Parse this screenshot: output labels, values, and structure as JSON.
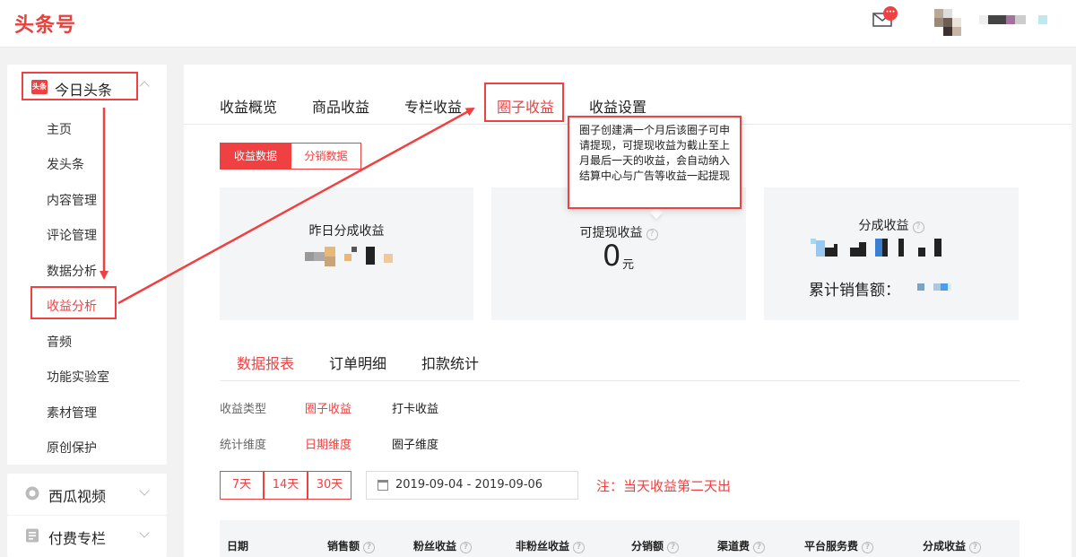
{
  "header": {
    "logo": "头条号",
    "mail_badge": "···",
    "colors": {
      "brand": "#e8403d",
      "accent": "#f04142"
    }
  },
  "sidebar": {
    "section_title": "今日头条",
    "section_icon": "头条",
    "items": [
      {
        "label": "主页"
      },
      {
        "label": "发头条"
      },
      {
        "label": "内容管理"
      },
      {
        "label": "评论管理"
      },
      {
        "label": "数据分析"
      },
      {
        "label": "收益分析",
        "active": true
      },
      {
        "label": "音频"
      },
      {
        "label": "功能实验室"
      },
      {
        "label": "素材管理"
      },
      {
        "label": "原创保护"
      }
    ],
    "other_sections": [
      {
        "label": "西瓜视频",
        "icon": "play-icon"
      },
      {
        "label": "付费专栏",
        "icon": "document-icon"
      }
    ]
  },
  "tabs": [
    {
      "label": "收益概览"
    },
    {
      "label": "商品收益"
    },
    {
      "label": "专栏收益"
    },
    {
      "label": "圈子收益",
      "active": true
    },
    {
      "label": "收益设置"
    }
  ],
  "segments": {
    "on": "收益数据",
    "off": "分销数据"
  },
  "tooltip": "圈子创建满一个月后该圈子可申请提现，可提现收益为截止至上月最后一天的收益，会自动纳入结算中心与广告等收益一起提现",
  "stats": {
    "yesterday_share": {
      "title": "昨日分成收益"
    },
    "withdrawable": {
      "title": "可提现收益",
      "value": "0",
      "unit": "元"
    },
    "share": {
      "title": "分成收益",
      "sales_label": "累计销售额："
    }
  },
  "subtabs": [
    {
      "label": "数据报表",
      "active": true
    },
    {
      "label": "订单明细"
    },
    {
      "label": "扣款统计"
    }
  ],
  "filters": {
    "type_label": "收益类型",
    "type_options": [
      {
        "label": "圈子收益",
        "active": true
      },
      {
        "label": "打卡收益"
      }
    ],
    "dimension_label": "统计维度",
    "dimension_options": [
      {
        "label": "日期维度",
        "active": true
      },
      {
        "label": "圈子维度"
      }
    ]
  },
  "date_ranges": [
    "7天",
    "14天",
    "30天"
  ],
  "date_range_value": "2019-09-04 - 2019-09-06",
  "note": "注：当天收益第二天出",
  "table_headers": [
    "日期",
    "销售额",
    "粉丝收益",
    "非粉丝收益",
    "分销额",
    "渠道费",
    "平台服务费",
    "分成收益"
  ],
  "help_glyph": "?"
}
